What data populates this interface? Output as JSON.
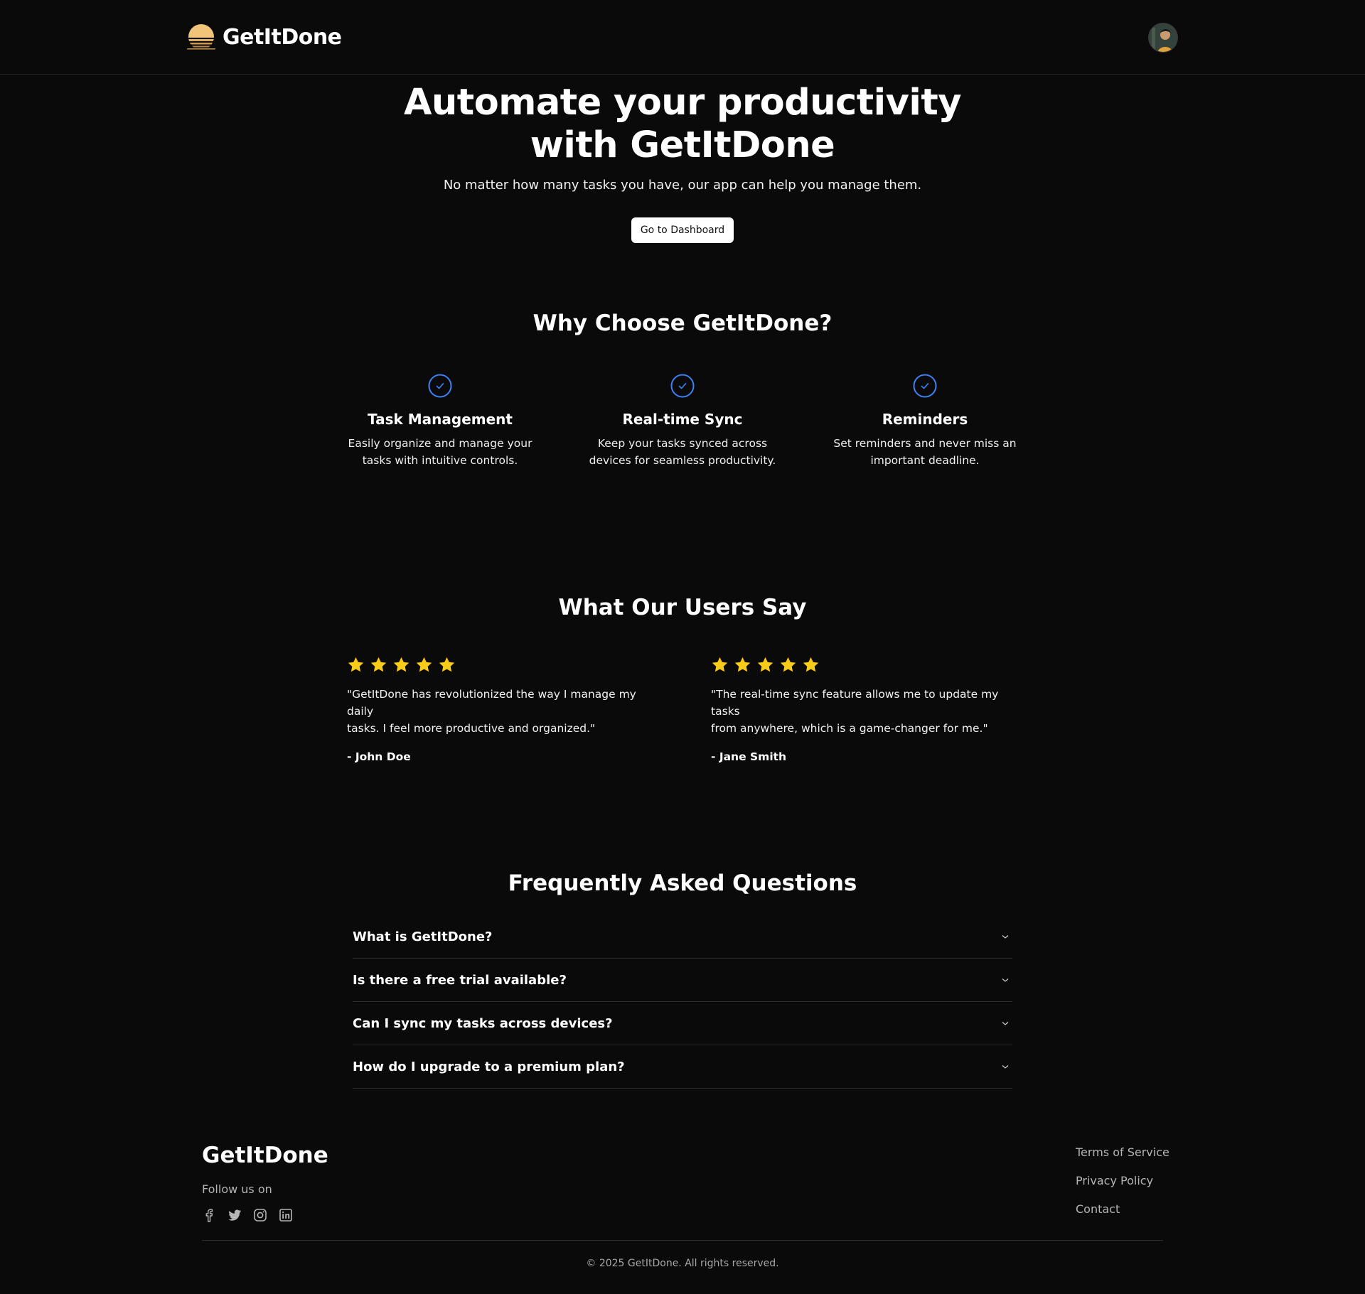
{
  "header": {
    "brand_name": "GetItDone",
    "logo_icon": "sunset-stripes-logo-icon",
    "avatar_icon": "user-avatar"
  },
  "hero": {
    "title_line1": "Automate your productivity",
    "title_line2": "with GetItDone",
    "subtitle": "No matter how many tasks you have, our app can help you manage them.",
    "cta_label": "Go to Dashboard"
  },
  "features": {
    "title": "Why Choose GetItDone?",
    "icon": "check-circle-icon",
    "accent_color": "#3b82f6",
    "items": [
      {
        "title": "Task Management",
        "desc_line1": "Easily organize and manage your",
        "desc_line2": "tasks with intuitive controls."
      },
      {
        "title": "Real-time Sync",
        "desc_line1": "Keep your tasks synced across",
        "desc_line2": "devices for seamless productivity."
      },
      {
        "title": "Reminders",
        "desc_line1": "Set reminders and never miss an",
        "desc_line2": "important deadline."
      }
    ]
  },
  "testimonials": {
    "title": "What Our Users Say",
    "star_color": "#facc15",
    "items": [
      {
        "rating": 5,
        "quote_line1": "\"GetItDone has revolutionized the way I manage my daily",
        "quote_line2": "tasks. I feel more productive and organized.\"",
        "author": "- John Doe"
      },
      {
        "rating": 5,
        "quote_line1": "\"The real-time sync feature allows me to update my tasks",
        "quote_line2": "from anywhere, which is a game-changer for me.\"",
        "author": "- Jane Smith"
      }
    ]
  },
  "faq": {
    "title": "Frequently Asked Questions",
    "items": [
      {
        "question": "What is GetItDone?"
      },
      {
        "question": "Is there a free trial available?"
      },
      {
        "question": "Can I sync my tasks across devices?"
      },
      {
        "question": "How do I upgrade to a premium plan?"
      }
    ]
  },
  "footer": {
    "brand_name": "GetItDone",
    "follow_label": "Follow us on",
    "socials": [
      "facebook-icon",
      "twitter-icon",
      "instagram-icon",
      "linkedin-icon"
    ],
    "links": [
      "Terms of Service",
      "Privacy Policy",
      "Contact"
    ],
    "copyright": "© 2025 GetItDone. All rights reserved."
  }
}
